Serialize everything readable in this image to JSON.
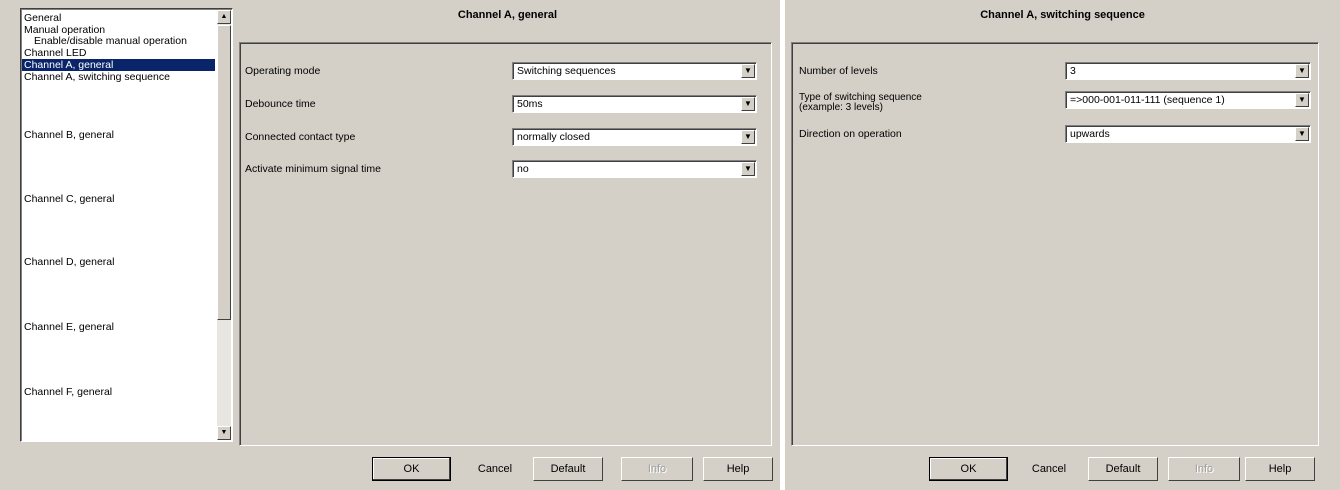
{
  "windowA": {
    "title": "Channel A, general",
    "tree": [
      {
        "label": "General",
        "selected": false,
        "indent": false
      },
      {
        "label": "Manual operation",
        "selected": false,
        "indent": false
      },
      {
        "label": "Enable/disable manual operation",
        "selected": false,
        "indent": true
      },
      {
        "label": "Channel LED",
        "selected": false,
        "indent": false
      },
      {
        "label": "Channel A, general",
        "selected": true,
        "indent": false
      },
      {
        "label": "Channel A, switching sequence",
        "selected": false,
        "indent": false
      },
      {
        "label": "Channel B, general",
        "selected": false,
        "indent": false
      },
      {
        "label": "Channel C, general",
        "selected": false,
        "indent": false
      },
      {
        "label": "Channel D, general",
        "selected": false,
        "indent": false
      },
      {
        "label": "Channel E, general",
        "selected": false,
        "indent": false
      },
      {
        "label": "Channel F, general",
        "selected": false,
        "indent": false
      }
    ],
    "params": [
      {
        "label": "Operating mode",
        "value": "Switching sequences"
      },
      {
        "label": "Debounce time",
        "value": "50ms"
      },
      {
        "label": "Connected contact type",
        "value": "normally closed"
      },
      {
        "label": "Activate minimum signal time",
        "value": "no"
      }
    ],
    "buttons": {
      "ok": "OK",
      "cancel": "Cancel",
      "default": "Default",
      "info": "Info",
      "help": "Help"
    }
  },
  "windowB": {
    "title": "Channel A, switching sequence",
    "params": [
      {
        "label": "Number of levels",
        "label2": "",
        "value": "3"
      },
      {
        "label": "Type of switching sequence",
        "label2": "(example: 3 levels)",
        "value": "=>000-001-011-111 (sequence 1)"
      },
      {
        "label": "Direction on operation",
        "label2": "",
        "value": "upwards"
      }
    ],
    "buttons": {
      "ok": "OK",
      "cancel": "Cancel",
      "default": "Default",
      "info": "Info",
      "help": "Help"
    }
  },
  "icons": {
    "scroll_up": "scroll-up-arrow",
    "scroll_down": "scroll-down-arrow",
    "dropdown": "dropdown-arrow"
  },
  "colors": {
    "selection": "#0a246a",
    "dialog_bg": "#d4d0c8"
  }
}
